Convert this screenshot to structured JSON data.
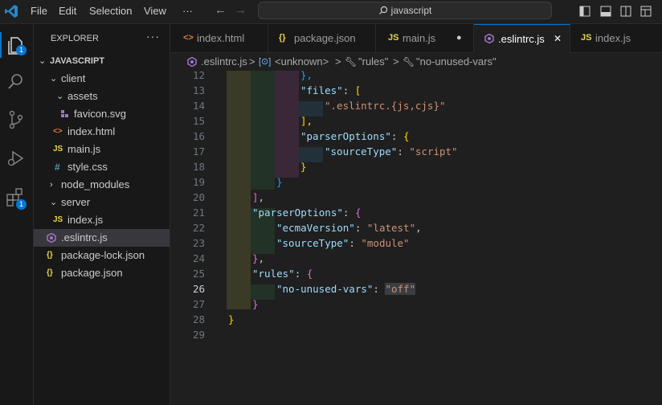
{
  "menu": [
    "File",
    "Edit",
    "Selection",
    "View",
    "···"
  ],
  "search": {
    "text": "javascript"
  },
  "activity_badges": {
    "explorer": "1",
    "extensions": "1"
  },
  "sidebar": {
    "title": "EXPLORER",
    "more": "···",
    "root": "JAVASCRIPT",
    "items": [
      {
        "label": "client"
      },
      {
        "label": "assets"
      },
      {
        "label": "favicon.svg"
      },
      {
        "label": "index.html"
      },
      {
        "label": "main.js"
      },
      {
        "label": "style.css"
      },
      {
        "label": "node_modules"
      },
      {
        "label": "server"
      },
      {
        "label": "index.js"
      },
      {
        "label": ".eslintrc.js"
      },
      {
        "label": "package-lock.json"
      },
      {
        "label": "package.json"
      }
    ],
    "icon_glyphs": {
      "js": "JS",
      "css": "#",
      "json": "{}",
      "html": "<>"
    }
  },
  "tabs": [
    {
      "label": "index.html"
    },
    {
      "label": "package.json"
    },
    {
      "label": "main.js"
    },
    {
      "label": ".eslintrc.js"
    },
    {
      "label": "index.js"
    }
  ],
  "tab_close": "✕",
  "tab_modified": "●",
  "breadcrumb": {
    "file": ".eslintrc.js",
    "seg1": "<unknown>",
    "seg2": "\"rules\"",
    "seg3": "\"no-unused-vars\"",
    "sep": ">"
  },
  "editor": {
    "line_numbers": [
      "12",
      "13",
      "14",
      "15",
      "16",
      "17",
      "18",
      "19",
      "20",
      "21",
      "22",
      "23",
      "24",
      "25",
      "26",
      "27",
      "28",
      "29"
    ],
    "current_line": "26"
  },
  "code": {
    "l12": "},",
    "l13_key": "\"files\"",
    "l13_rest": ": ",
    "l13_br": "[",
    "l14_str": "\".eslintrc.{js,cjs}\"",
    "l15": "],",
    "l16_key": "\"parserOptions\"",
    "l16_rest": ": ",
    "l16_br": "{",
    "l17_key": "\"sourceType\"",
    "l17_rest": ": ",
    "l17_val": "\"script\"",
    "l18": "}",
    "l19": "}",
    "l20_br": "]",
    "l20_rest": ",",
    "l21_key": "\"parserOptions\"",
    "l21_rest": ": ",
    "l21_br": "{",
    "l22_key": "\"ecmaVersion\"",
    "l22_rest": ": ",
    "l22_val": "\"latest\"",
    "l22_end": ",",
    "l23_key": "\"sourceType\"",
    "l23_rest": ": ",
    "l23_val": "\"module\"",
    "l24_br": "}",
    "l24_rest": ",",
    "l25_key": "\"rules\"",
    "l25_rest": ": ",
    "l25_br": "{",
    "l26_key": "\"no-unused-vars\"",
    "l26_rest": ": ",
    "l26_val": "\"off\"",
    "l27_br": "}",
    "l28_br": "}"
  },
  "colors": {
    "accent": "#0078d4",
    "badge": "#0078d4",
    "key": "#9cdcfe",
    "string": "#ce9178",
    "bracket_gold": "#ffd700",
    "bracket_purple": "#da70d6",
    "bracket_blue": "#179fff",
    "js_icon": "#e8d44d",
    "html_icon": "#e37933",
    "css_icon": "#519aba",
    "eslint_icon": "#a074c4"
  }
}
